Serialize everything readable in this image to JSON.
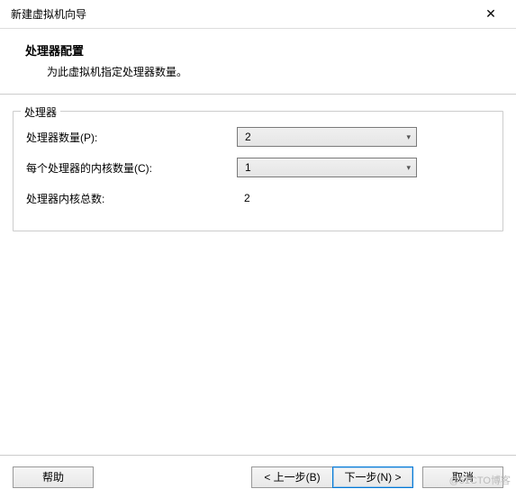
{
  "titlebar": {
    "title": "新建虚拟机向导",
    "close_icon": "✕"
  },
  "header": {
    "title": "处理器配置",
    "subtitle": "为此虚拟机指定处理器数量。"
  },
  "fieldset": {
    "legend": "处理器"
  },
  "form": {
    "processor_count_label": "处理器数量(P):",
    "processor_count_value": "2",
    "cores_per_label": "每个处理器的内核数量(C):",
    "cores_per_value": "1",
    "total_cores_label": "处理器内核总数:",
    "total_cores_value": "2"
  },
  "footer": {
    "help": "帮助",
    "back": "< 上一步(B)",
    "next": "下一步(N) >",
    "cancel": "取消"
  },
  "watermark": "@51CTO博客"
}
